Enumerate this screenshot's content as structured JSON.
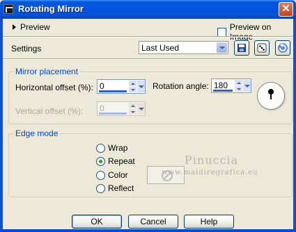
{
  "window": {
    "title": "Rotating Mirror",
    "close_icon": "close-icon"
  },
  "preview": {
    "toggle_label": "Preview",
    "preview_on_image_label": "Preview on Image",
    "preview_on_image_checked": false
  },
  "settings": {
    "label": "Settings",
    "preset_value": "Last Used",
    "save_icon": "save-preset-icon",
    "random_icon": "randomize-dice-icon",
    "reset_icon": "reset-icon"
  },
  "mirror_placement": {
    "title": "Mirror placement",
    "horizontal_offset_label": "Horizontal offset (%):",
    "horizontal_offset_value": "0",
    "rotation_angle_label": "Rotation angle:",
    "rotation_angle_value": "180",
    "vertical_offset_label": "Vertical offset (%):",
    "vertical_offset_value": "0"
  },
  "edge_mode": {
    "title": "Edge mode",
    "options": [
      "Wrap",
      "Repeat",
      "Color",
      "Reflect"
    ],
    "selected": "Repeat"
  },
  "watermark": {
    "title": "Pinuccia",
    "url": "www.maidiregrafica.eu"
  },
  "buttons": {
    "ok": "OK",
    "cancel": "Cancel",
    "help": "Help"
  },
  "colors": {
    "titlebar": "#0054e3",
    "dialog_bg": "#ece9d8",
    "group_label": "#0046d5"
  }
}
